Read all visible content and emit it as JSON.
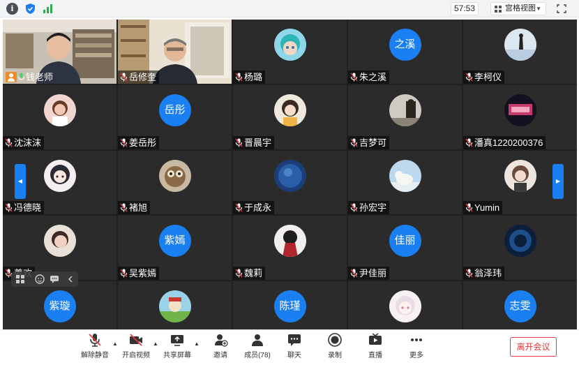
{
  "topbar": {
    "timer": "57:53",
    "view_label": "宫格视图"
  },
  "participants": [
    {
      "name": "钱老师",
      "kind": "video",
      "host": true
    },
    {
      "name": "岳修奎",
      "kind": "video"
    },
    {
      "name": "杨璐",
      "kind": "image",
      "art": "doll"
    },
    {
      "name": "朱之溪",
      "kind": "text",
      "avatar_text": "之溪"
    },
    {
      "name": "李柯仪",
      "kind": "image",
      "art": "sky"
    },
    {
      "name": "沈沫沫",
      "kind": "image",
      "art": "girl"
    },
    {
      "name": "姜岳彤",
      "kind": "text",
      "avatar_text": "岳彤"
    },
    {
      "name": "晋晨宇",
      "kind": "image",
      "art": "cartoon"
    },
    {
      "name": "吉梦可",
      "kind": "image",
      "art": "photo"
    },
    {
      "name": "潘真1220200376",
      "kind": "image",
      "art": "stage"
    },
    {
      "name": "冯德晓",
      "kind": "image",
      "art": "anime"
    },
    {
      "name": "褚旭",
      "kind": "image",
      "art": "owl"
    },
    {
      "name": "于成永",
      "kind": "image",
      "art": "night"
    },
    {
      "name": "孙宏宇",
      "kind": "image",
      "art": "bear"
    },
    {
      "name": "Yumin",
      "kind": "image",
      "art": "sketch"
    },
    {
      "name": "姜欢",
      "kind": "image",
      "art": "face"
    },
    {
      "name": "吴紫嫣",
      "kind": "text",
      "avatar_text": "紫嫣"
    },
    {
      "name": "魏莉",
      "kind": "image",
      "art": "red"
    },
    {
      "name": "尹佳丽",
      "kind": "text",
      "avatar_text": "佳丽"
    },
    {
      "name": "翁泽玮",
      "kind": "image",
      "art": "blue"
    },
    {
      "name": "",
      "kind": "text",
      "avatar_text": "紫璇"
    },
    {
      "name": "",
      "kind": "image",
      "art": "toy"
    },
    {
      "name": "",
      "kind": "text",
      "avatar_text": "陈瑾"
    },
    {
      "name": "",
      "kind": "image",
      "art": "chibi"
    },
    {
      "name": "",
      "kind": "text",
      "avatar_text": "志雯"
    }
  ],
  "toolbar": {
    "unmute": "解除静音",
    "video": "开启视频",
    "share": "共享屏幕",
    "invite": "邀请",
    "members": "成员(78)",
    "chat": "聊天",
    "record": "录制",
    "live": "直播",
    "more": "更多",
    "leave": "离开会议"
  },
  "colors": {
    "accent": "#1a7ff0",
    "leave": "#e0393b",
    "tile": "#2b2b2b"
  }
}
